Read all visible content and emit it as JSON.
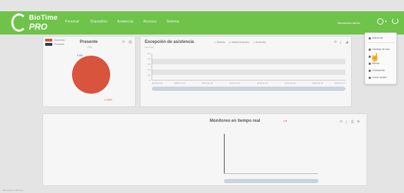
{
  "header": {
    "logo_top": "BioTime",
    "logo_bottom": "PRO",
    "nav": [
      "Personal",
      "Dispositivo",
      "Asistencia",
      "Accesos",
      "Sistema"
    ],
    "user_name": "Bienvenido admin"
  },
  "presente_panel": {
    "title": "Presente",
    "subtitle": "Hoy",
    "legend": [
      {
        "label": "Ausencia",
        "color": "#d8543c"
      },
      {
        "label": "Presente",
        "color": "#2b3a55"
      }
    ],
    "pie_label_top": "0 0%",
    "pie_label_bottom": "1 100%",
    "pie_color": "#d8543c"
  },
  "excepcion_panel": {
    "title": "Excepción de asistencia",
    "unit": "Personas",
    "legend": [
      "Retardo",
      "Salida temprano",
      "Ausencia"
    ],
    "y_ticks": [
      "1.0",
      "0.8",
      "0.6",
      "0.4",
      "0.2",
      "0"
    ],
    "x_ticks": [
      "2019-12-12",
      "2019-12-14",
      "2019-12-16",
      "2019-12-22",
      "2019-12-24",
      "2019-12-26",
      "2019-01-02",
      "2019-01-07"
    ]
  },
  "monitor_panel": {
    "title": "Monitoreo en tiempo real"
  },
  "user_menu": {
    "items": [
      "Acerca de",
      "Cambiar de clav",
      "Guía",
      "Idioma",
      "Contraseña",
      "Cerrar sesión"
    ]
  },
  "footer": "Bienvenido a BioTime"
}
